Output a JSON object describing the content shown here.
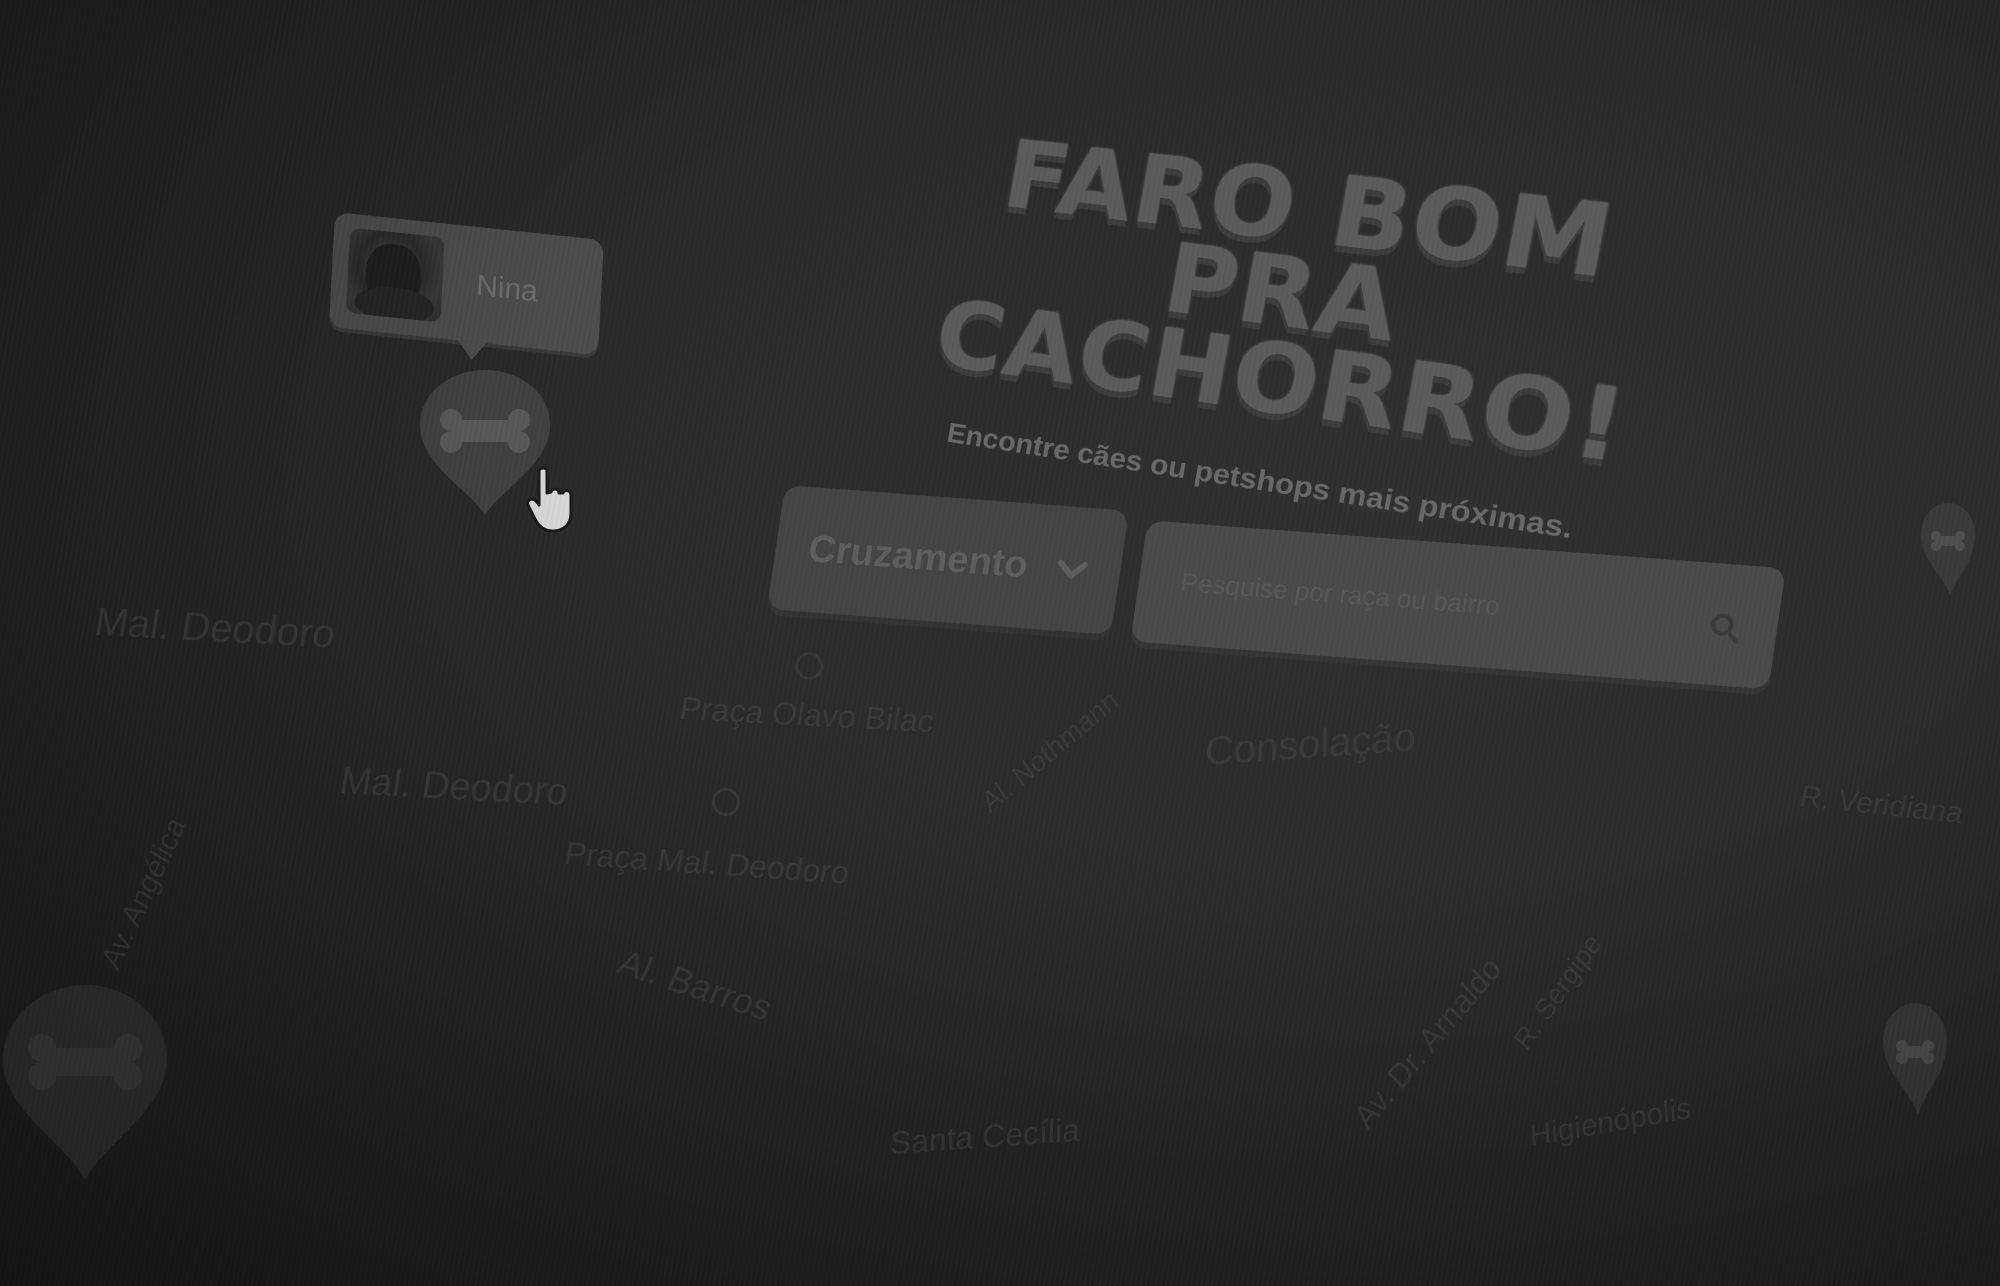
{
  "hero": {
    "title_line1": "FARO BOM",
    "title_line2": "PRA CACHORRO!",
    "subtitle": "Encontre cães ou petshops mais próximas."
  },
  "search": {
    "filter_value": "Cruzamento",
    "placeholder": "Pesquise por raça ou bairro",
    "icon": "search-icon"
  },
  "map": {
    "marker_popup": {
      "name": "Nina"
    },
    "streets": [
      "Mal. Deodoro",
      "Praça Olavo Bilac",
      "Mal. Deodoro",
      "Praça Mal. Deodoro",
      "Al. Barros",
      "Al. Nothmann",
      "Santa Cecília",
      "Av. Dr. Arnaldo",
      "Consolação",
      "Av. Angélica",
      "R. Sergipe",
      "Higienópolis",
      "R. Veridiana"
    ],
    "marker_icon": "bone-icon"
  },
  "colors": {
    "background": "#262626",
    "panel": "#444444",
    "text_dim": "#5e5e5e"
  }
}
